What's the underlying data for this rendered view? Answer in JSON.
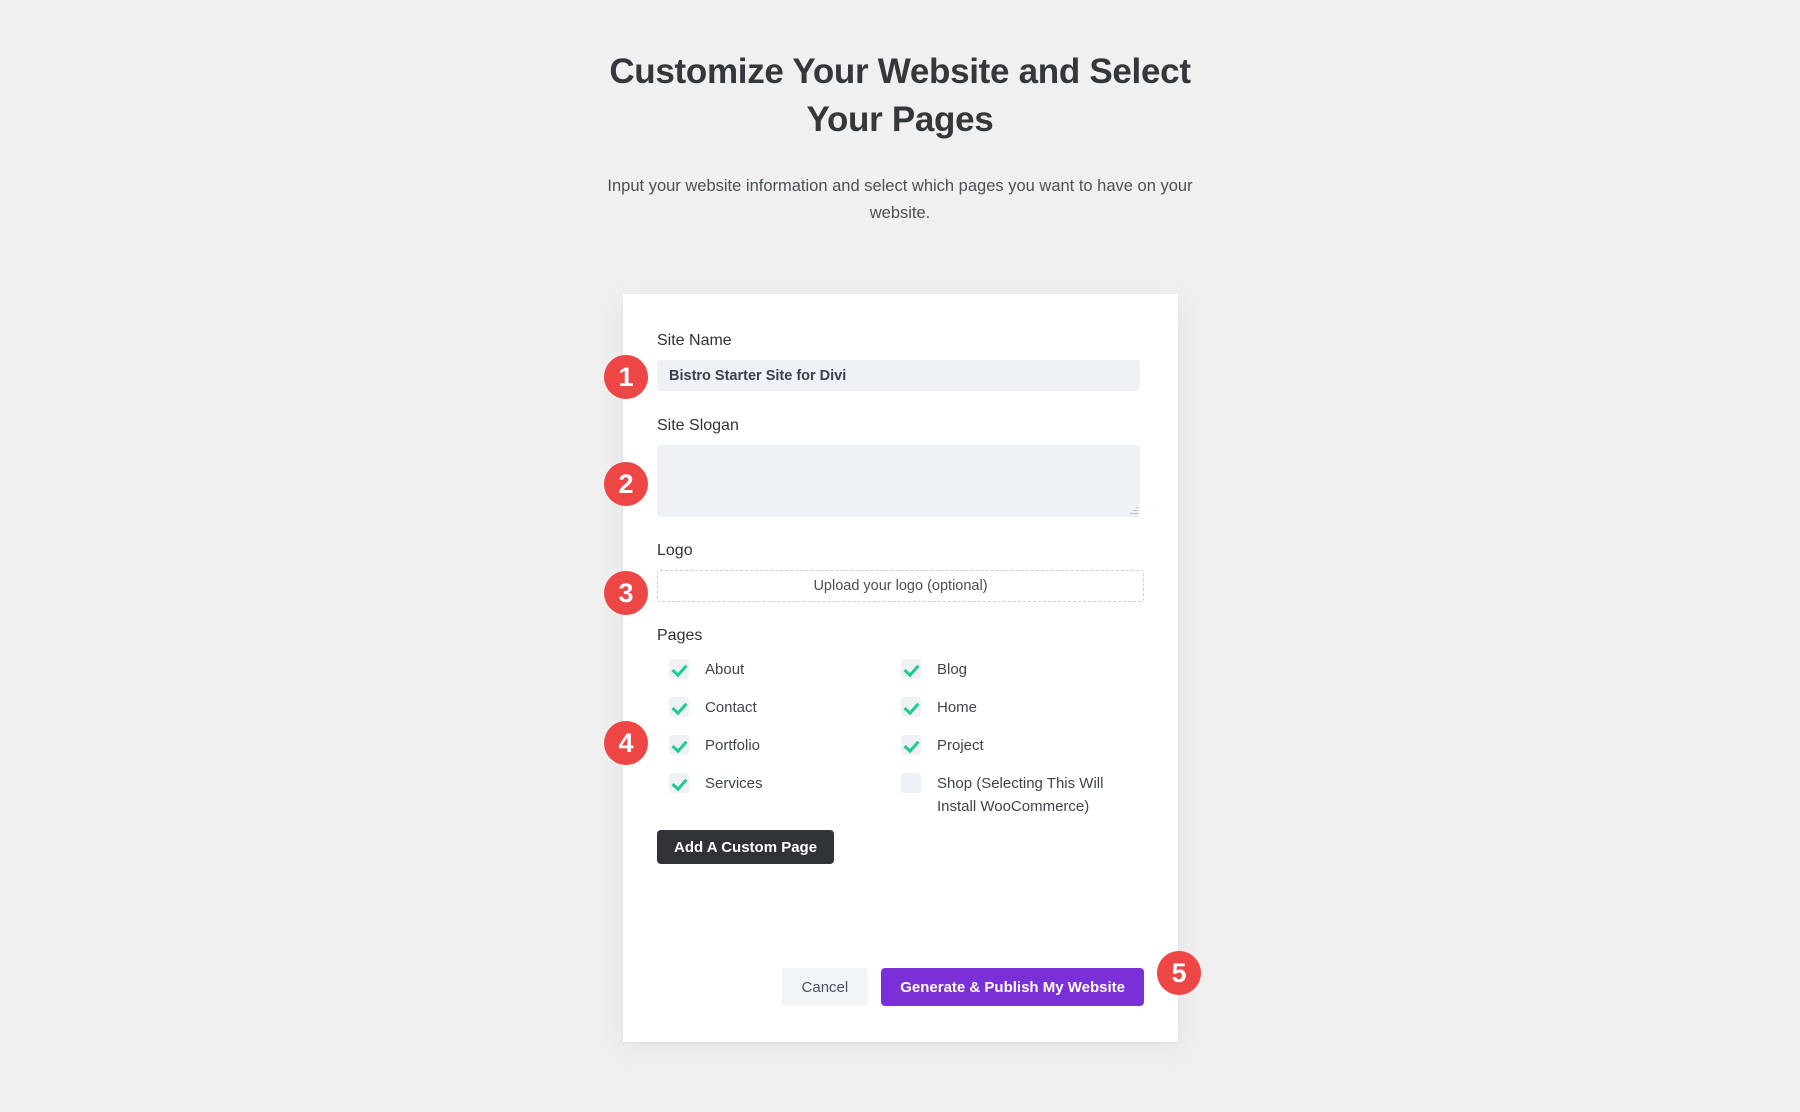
{
  "header": {
    "title": "Customize Your Website and Select Your Pages",
    "subtitle": "Input your website information and select which pages you want to have on your website."
  },
  "form": {
    "site_name": {
      "label": "Site Name",
      "value": "Bistro Starter Site for Divi",
      "placeholder": ""
    },
    "site_slogan": {
      "label": "Site Slogan",
      "value": "",
      "placeholder": ""
    },
    "logo": {
      "label": "Logo",
      "upload_text": "Upload your logo (optional)"
    },
    "pages": {
      "label": "Pages",
      "options": [
        {
          "label": "About",
          "checked": true
        },
        {
          "label": "Blog",
          "checked": true
        },
        {
          "label": "Contact",
          "checked": true
        },
        {
          "label": "Home",
          "checked": true
        },
        {
          "label": "Portfolio",
          "checked": true
        },
        {
          "label": "Project",
          "checked": true
        },
        {
          "label": "Services",
          "checked": true
        },
        {
          "label": "Shop (Selecting This Will Install WooCommerce)",
          "checked": false
        }
      ]
    },
    "add_custom_page_label": "Add A Custom Page"
  },
  "footer": {
    "cancel_label": "Cancel",
    "publish_label": "Generate & Publish My Website"
  },
  "badges": [
    {
      "number": "1"
    },
    {
      "number": "2"
    },
    {
      "number": "3"
    },
    {
      "number": "4"
    },
    {
      "number": "5"
    }
  ],
  "colors": {
    "background": "#f0f0f0",
    "card": "#ffffff",
    "accent_purple": "#7b2fd6",
    "badge_red": "#ee4545",
    "check_green": "#1fcb8f",
    "dark_button": "#2f3337",
    "input_bg": "#eef1f5"
  }
}
